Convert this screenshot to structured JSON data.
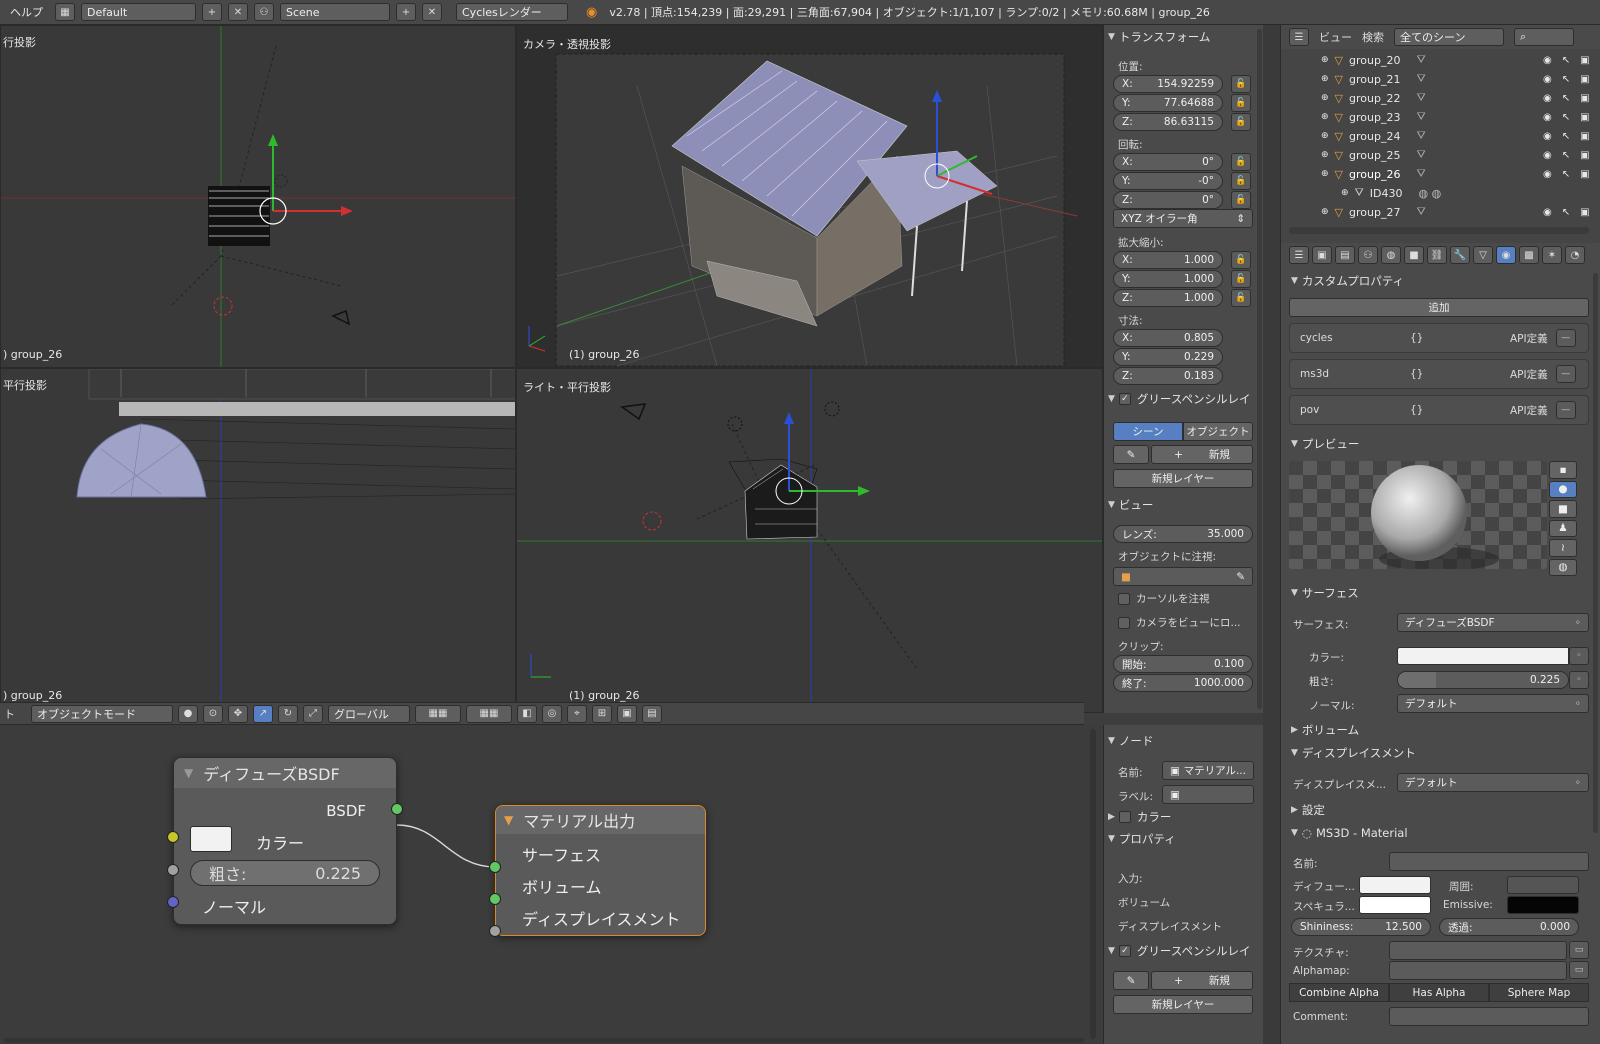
{
  "topbar": {
    "help_menu": "ヘルプ",
    "screen_layout": "Default",
    "scene_name": "Scene",
    "render_engine": "Cyclesレンダー",
    "stats": "v2.78 | 頂点:154,239 | 面:29,291 | 三角面:67,904 | オブジェクト:1/1,107 | ランプ:0/2 | メモリ:60.68M | group_26"
  },
  "viewports": {
    "top_left": {
      "title": "行投影",
      "footer": ") group_26"
    },
    "camera": {
      "title": "カメラ・透視投影",
      "footer": "(1) group_26"
    },
    "bottom_left": {
      "title": "平行投影",
      "footer": ") group_26"
    },
    "light": {
      "title": "ライト・平行投影",
      "footer": "(1) group_26"
    }
  },
  "view_toolbar": {
    "left_cut": "ト",
    "mode": "オブジェクトモード",
    "orientation": "グローバル"
  },
  "transform": {
    "header": "トランスフォーム",
    "location_label": "位置:",
    "location": [
      {
        "axis": "X:",
        "value": "154.92259"
      },
      {
        "axis": "Y:",
        "value": "77.64688"
      },
      {
        "axis": "Z:",
        "value": "86.63115"
      }
    ],
    "rotation_label": "回転:",
    "rotation": [
      {
        "axis": "X:",
        "value": "0°"
      },
      {
        "axis": "Y:",
        "value": "-0°"
      },
      {
        "axis": "Z:",
        "value": "0°"
      }
    ],
    "rotation_mode": "XYZ オイラー角",
    "scale_label": "拡大縮小:",
    "scale": [
      {
        "axis": "X:",
        "value": "1.000"
      },
      {
        "axis": "Y:",
        "value": "1.000"
      },
      {
        "axis": "Z:",
        "value": "1.000"
      }
    ],
    "dimensions_label": "寸法:",
    "dimensions": [
      {
        "axis": "X:",
        "value": "0.805"
      },
      {
        "axis": "Y:",
        "value": "0.229"
      },
      {
        "axis": "Z:",
        "value": "0.183"
      }
    ],
    "grease_header": "グリースペンシルレイ",
    "grease_tab_scene": "シーン",
    "grease_tab_object": "オブジェクト",
    "grease_new": "新規",
    "grease_new_layer": "新規レイヤー",
    "view_header": "ビュー",
    "lens_label": "レンズ:",
    "lens_value": "35.000",
    "lock_to_object": "オブジェクトに注視:",
    "lock_cursor": "カーソルを注視",
    "lock_camera": "カメラをビューにロ...",
    "clip_label": "クリップ:",
    "clip_start_label": "開始:",
    "clip_start": "0.100",
    "clip_end_label": "終了:",
    "clip_end": "1000.000"
  },
  "outliner": {
    "view_menu": "ビュー",
    "search_menu": "検索",
    "scene_filter": "全てのシーン",
    "items": [
      {
        "name": "group_20"
      },
      {
        "name": "group_21"
      },
      {
        "name": "group_22"
      },
      {
        "name": "group_23"
      },
      {
        "name": "group_24"
      },
      {
        "name": "group_25"
      },
      {
        "name": "group_26"
      },
      {
        "name": "ID430"
      },
      {
        "name": "group_27"
      }
    ]
  },
  "properties": {
    "custom_header": "カスタムプロパティ",
    "add_button": "追加",
    "custom_props": [
      {
        "name": "cycles",
        "value": "{}",
        "tag": "API定義"
      },
      {
        "name": "ms3d",
        "value": "{}",
        "tag": "API定義"
      },
      {
        "name": "pov",
        "value": "{}",
        "tag": "API定義"
      }
    ],
    "preview_header": "プレビュー",
    "surface_header": "サーフェス",
    "surface_label": "サーフェス:",
    "surface_value": "ディフューズBSDF",
    "color_label": "カラー:",
    "roughness_label": "粗さ:",
    "roughness_value": "0.225",
    "roughness_fraction": 0.225,
    "normal_label": "ノーマル:",
    "normal_value": "デフォルト",
    "volume_header": "ボリューム",
    "displacement_header": "ディスプレイスメント",
    "displacement_label": "ディスプレイスメ...",
    "displacement_value": "デフォルト",
    "settings_header": "設定",
    "ms3d_header": "MS3D - Material",
    "name_label": "名前:",
    "diffuse_label": "ディフュー...",
    "ambient_label": "周囲:",
    "specular_label": "スペキュラ...",
    "emissive_label": "Emissive:",
    "shininess_label": "Shininess:",
    "shininess_value": "12.500",
    "transparency_label": "透過:",
    "transparency_value": "0.000",
    "texture_label": "テクスチャ:",
    "alphamap_label": "Alphamap:",
    "mode_buttons": [
      "Combine Alpha",
      "Has Alpha",
      "Sphere Map"
    ],
    "comment_label": "Comment:"
  },
  "node_editor": {
    "diffuse_node": {
      "title": "ディフューズBSDF",
      "output": "BSDF",
      "color_label": "カラー",
      "roughness_label": "粗さ:",
      "roughness_value": "0.225",
      "normal_label": "ノーマル"
    },
    "output_node": {
      "title": "マテリアル出力",
      "inputs": [
        "サーフェス",
        "ボリューム",
        "ディスプレイスメント"
      ]
    }
  },
  "node_sidebar": {
    "node_header": "ノード",
    "name_label": "名前:",
    "name_value": "マテリアル...",
    "label_label": "ラベル:",
    "color_header": "カラー",
    "props_header": "プロパティ",
    "input_label": "入力:",
    "inputs": [
      "ボリューム",
      "ディスプレイスメント"
    ],
    "grease_header": "グリースペンシルレイ",
    "grease_new": "新規",
    "grease_new_layer": "新規レイヤー"
  },
  "colors": {
    "accent_blue": "#5680c2",
    "socket_green": "#63c763",
    "socket_yellow": "#c7c729",
    "socket_gray": "#a1a1a1",
    "socket_purple": "#6363c7",
    "output_node_border": "#d98a2b"
  }
}
